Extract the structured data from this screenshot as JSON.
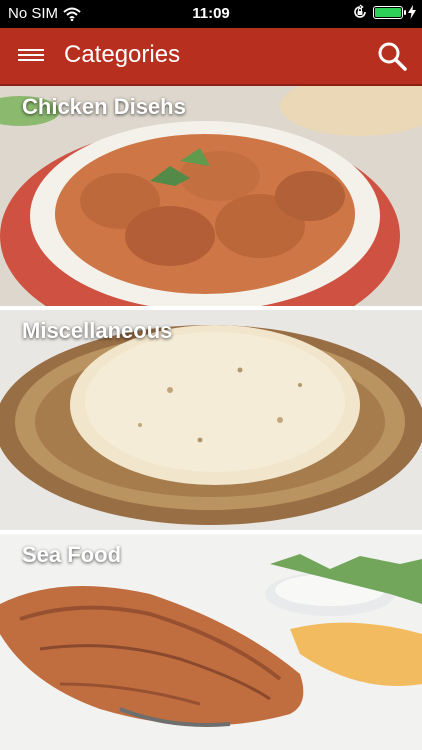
{
  "status_bar": {
    "carrier": "No SIM",
    "time": "11:09",
    "battery_level": 1.0
  },
  "header": {
    "title": "Categories",
    "menu_icon": "hamburger-menu-icon",
    "search_icon": "search-icon",
    "background_color": "#b7301f"
  },
  "categories": [
    {
      "label": "Chicken Disehs",
      "image": "chicken-curry-dish"
    },
    {
      "label": "Miscellaneous",
      "image": "roti-bread-on-plate"
    },
    {
      "label": "Sea Food",
      "image": "grilled-fish-steak-with-lemon"
    }
  ]
}
